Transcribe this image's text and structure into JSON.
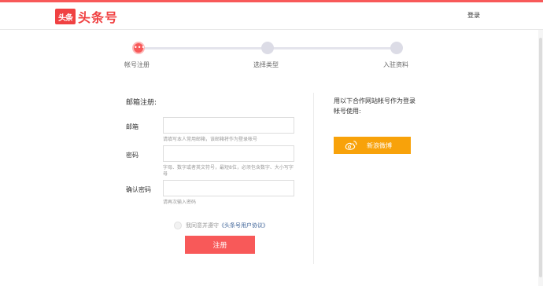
{
  "header": {
    "logo_badge": "头条",
    "logo_text": "头条号",
    "login": "登录"
  },
  "steps": [
    {
      "label": "帐号注册",
      "active": true
    },
    {
      "label": "选择类型",
      "active": false
    },
    {
      "label": "入驻资料",
      "active": false
    }
  ],
  "form": {
    "section_title": "邮箱注册:",
    "email_label": "邮箱",
    "email_value": "",
    "email_hint": "请填写本人常用邮箱，该邮箱将作为登录帐号",
    "password_label": "密码",
    "password_value": "",
    "password_hint": "字母、数字或者英文符号，最短8位，必须包含数字、大小写字母",
    "confirm_label": "确认密码",
    "confirm_value": "",
    "confirm_hint": "请再次输入密码",
    "agree_text": "我同意并遵守",
    "agree_link": "《头条号用户协议》",
    "submit": "注册"
  },
  "partner": {
    "text": "用以下合作网站帐号作为登录帐号使用:",
    "weibo_label": "新浪微博"
  },
  "colors": {
    "accent": "#f85959",
    "weibo": "#f8a20a",
    "link": "#406599"
  }
}
